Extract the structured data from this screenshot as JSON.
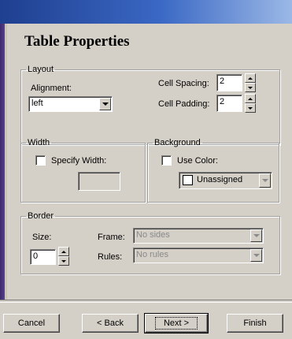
{
  "dialog": {
    "title": "Table Properties"
  },
  "layout": {
    "legend": "Layout",
    "alignment_label": "Alignment:",
    "alignment_value": "left",
    "cell_spacing_label": "Cell Spacing:",
    "cell_spacing_value": "2",
    "cell_padding_label": "Cell Padding:",
    "cell_padding_value": "2"
  },
  "width": {
    "legend": "Width",
    "specify_label": "Specify Width:",
    "specify_checked": false,
    "value": ""
  },
  "background": {
    "legend": "Background",
    "use_color_label": "Use Color:",
    "use_color_checked": false,
    "color_value": "Unassigned"
  },
  "border": {
    "legend": "Border",
    "size_label": "Size:",
    "size_value": "0",
    "frame_label": "Frame:",
    "frame_value": "No sides",
    "rules_label": "Rules:",
    "rules_value": "No rules"
  },
  "buttons": {
    "cancel": "Cancel",
    "back": "< Back",
    "next": "Next >",
    "finish": "Finish"
  }
}
